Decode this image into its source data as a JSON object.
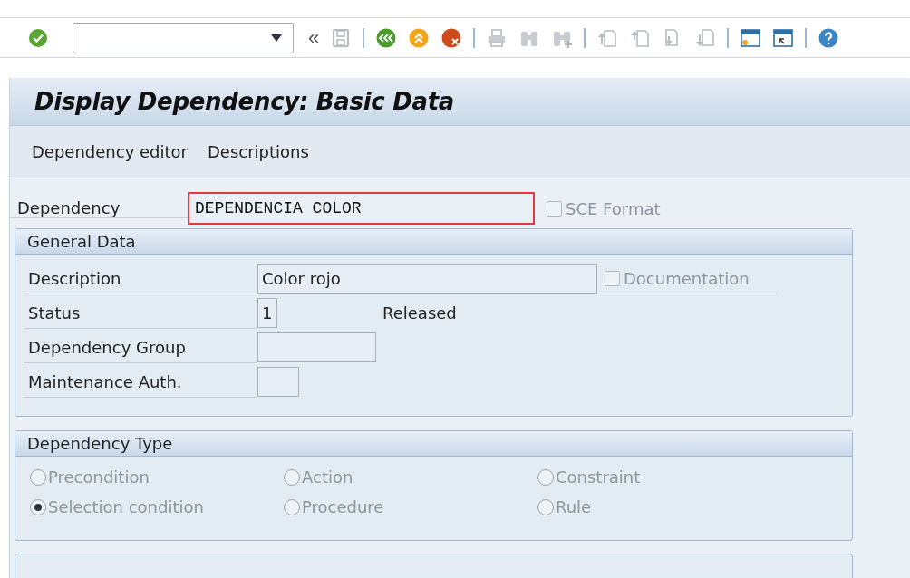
{
  "toolbar": {
    "buttons": [
      {
        "kind": "ok"
      },
      {
        "kind": "field"
      },
      {
        "kind": "collapse",
        "label": "«"
      },
      {
        "kind": "save"
      },
      {
        "kind": "sep"
      },
      {
        "kind": "back"
      },
      {
        "kind": "exit"
      },
      {
        "kind": "cancel"
      },
      {
        "kind": "sep"
      },
      {
        "kind": "print"
      },
      {
        "kind": "find"
      },
      {
        "kind": "findnext"
      },
      {
        "kind": "sep"
      },
      {
        "kind": "first"
      },
      {
        "kind": "prev"
      },
      {
        "kind": "next"
      },
      {
        "kind": "last"
      },
      {
        "kind": "sep"
      },
      {
        "kind": "newsession"
      },
      {
        "kind": "shortcut"
      },
      {
        "kind": "sep"
      },
      {
        "kind": "help"
      }
    ]
  },
  "title": "Display Dependency: Basic Data",
  "menu": [
    "Dependency editor",
    "Descriptions"
  ],
  "dependency": {
    "label": "Dependency",
    "value": "DEPENDENCIA COLOR",
    "focused": true,
    "sce_format": {
      "label": "SCE Format",
      "checked": false,
      "disabled": true
    }
  },
  "general_data": {
    "title": "General Data",
    "rows": [
      {
        "label": "Description",
        "value": "Color rojo",
        "checkbox": {
          "label": "Documentation",
          "checked": false,
          "disabled": true
        }
      },
      {
        "label": "Status",
        "value": "1",
        "note": "Released"
      },
      {
        "label": "Dependency Group"
      },
      {
        "label": "Maintenance Auth."
      }
    ]
  },
  "dependency_type": {
    "title": "Dependency Type",
    "disabled": true,
    "options": [
      {
        "label": "Precondition",
        "selected": false
      },
      {
        "label": "Action",
        "selected": false
      },
      {
        "label": "Constraint",
        "selected": false
      },
      {
        "label": "Selection condition",
        "selected": true
      },
      {
        "label": "Procedure",
        "selected": false
      },
      {
        "label": "Rule",
        "selected": false
      }
    ]
  }
}
